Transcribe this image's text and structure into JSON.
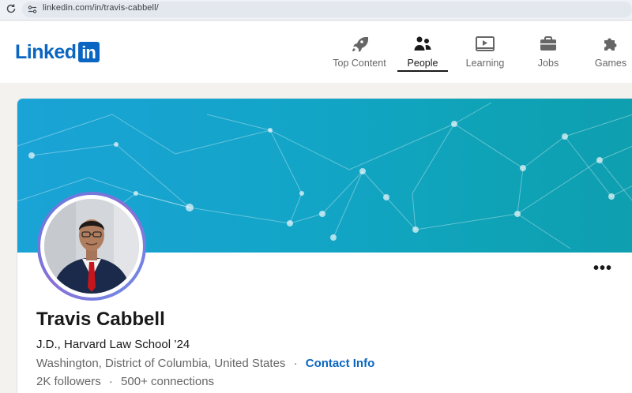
{
  "browser": {
    "url": "linkedin.com/in/travis-cabbell/"
  },
  "brand": {
    "word": "Linked",
    "box": "in",
    "color": "#0a66c2"
  },
  "nav": {
    "items": [
      {
        "label": "Top Content",
        "icon": "rocket-icon",
        "active": false
      },
      {
        "label": "People",
        "icon": "people-icon",
        "active": true
      },
      {
        "label": "Learning",
        "icon": "video-player-icon",
        "active": false
      },
      {
        "label": "Jobs",
        "icon": "briefcase-icon",
        "active": false
      },
      {
        "label": "Games",
        "icon": "puzzle-icon",
        "active": false
      }
    ]
  },
  "profile": {
    "name": "Travis Cabbell",
    "headline": "J.D., Harvard Law School ’24",
    "location": "Washington, District of Columbia, United States",
    "separator": "·",
    "contact_label": "Contact Info",
    "followers": "2K followers",
    "connections": "500+ connections",
    "more_label": "•••"
  },
  "colors": {
    "banner_start": "#1aa3d6",
    "banner_end": "#0e9fb0",
    "link": "#0a66c2"
  }
}
